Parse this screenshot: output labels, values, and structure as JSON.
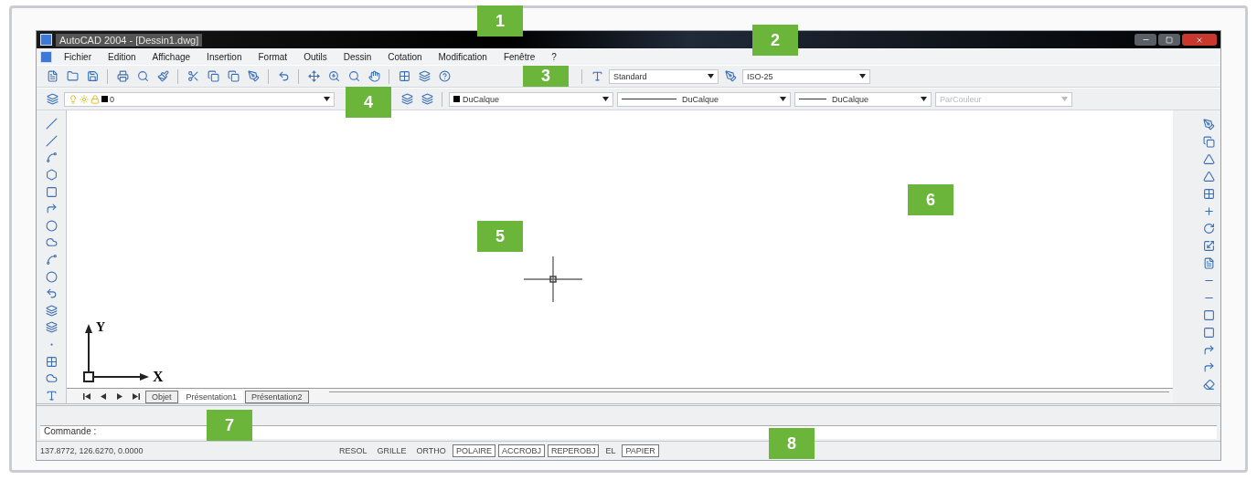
{
  "window": {
    "title": "AutoCAD 2004 - [Dessin1.dwg]"
  },
  "menu": [
    "Fichier",
    "Edition",
    "Affichage",
    "Insertion",
    "Format",
    "Outils",
    "Dessin",
    "Cotation",
    "Modification",
    "Fenêtre",
    "?"
  ],
  "styles_toolbar": {
    "text_style": "Standard",
    "dim_style": "ISO-25"
  },
  "properties_toolbar": {
    "layer": "0",
    "color_setting": "DuCalque",
    "linetype": "DuCalque",
    "lineweight": "DuCalque",
    "plot_style": {
      "value": "ParCouleur",
      "disabled": true
    }
  },
  "ucs_icon": {
    "y_label": "Y",
    "x_label": "X"
  },
  "layout_tabs": [
    {
      "label": "Objet",
      "selected": false
    },
    {
      "label": "Présentation1",
      "selected": true
    },
    {
      "label": "Présentation2",
      "selected": false
    }
  ],
  "command_line": {
    "prompt": "Commande :"
  },
  "status_bar": {
    "coordinates": "137.8772, 126.6270, 0.0000",
    "toggles": [
      {
        "label": "RESOL",
        "on": false
      },
      {
        "label": "GRILLE",
        "on": false
      },
      {
        "label": "ORTHO",
        "on": false
      },
      {
        "label": "POLAIRE",
        "on": true
      },
      {
        "label": "ACCROBJ",
        "on": true
      },
      {
        "label": "REPEROBJ",
        "on": true
      },
      {
        "label": "EL",
        "on": false
      },
      {
        "label": "PAPIER",
        "on": true
      }
    ]
  },
  "callouts": [
    "1",
    "2",
    "3",
    "4",
    "5",
    "6",
    "7",
    "8"
  ]
}
